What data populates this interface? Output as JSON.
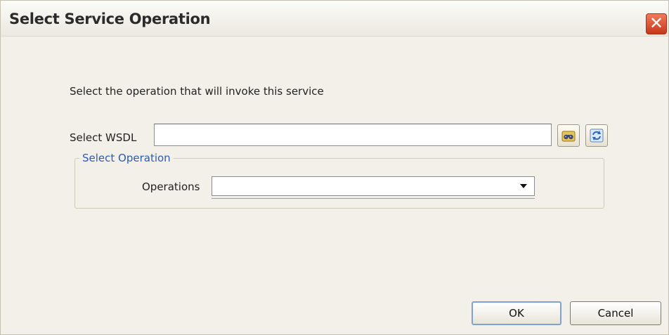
{
  "window": {
    "title": "Select Service Operation",
    "close_glyph": "✕"
  },
  "instruction": "Select the operation that will invoke this service",
  "wsdl": {
    "label": "Select WSDL",
    "value": "",
    "placeholder": "",
    "browse_icon": "binoculars-icon",
    "refresh_icon": "refresh-icon"
  },
  "operation_group": {
    "legend": "Select Operation",
    "operations_label": "Operations",
    "selected_value": ""
  },
  "buttons": {
    "ok": "OK",
    "cancel": "Cancel"
  },
  "colors": {
    "legend_text": "#2b5bb7",
    "close_button": "#d9452a",
    "background": "#f2f0e8"
  }
}
